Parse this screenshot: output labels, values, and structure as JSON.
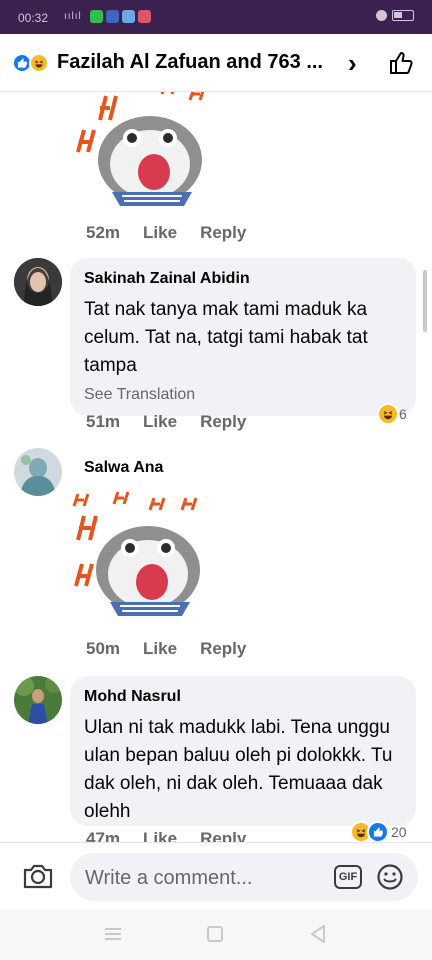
{
  "status_bar": {
    "time": "00:32",
    "signal": "ıılıl"
  },
  "header": {
    "title": "Fazilah Al Zafuan and 763 ...",
    "chevron": "›"
  },
  "sticker": {
    "text_lines": [
      "HA",
      "HA",
      "HA",
      "HA",
      "HA",
      "HA",
      "HA"
    ]
  },
  "comments": [
    {
      "time": "52m",
      "like": "Like",
      "reply": "Reply"
    },
    {
      "author": "Sakinah Zainal Abidin",
      "text": "Tat nak tanya mak tami maduk ka celum. Tat na, tatgi tami habak tat tampa",
      "see_translation": "See Translation",
      "time": "51m",
      "like": "Like",
      "reply": "Reply",
      "reaction_count": "6"
    },
    {
      "author": "Salwa Ana",
      "time": "50m",
      "like": "Like",
      "reply": "Reply"
    },
    {
      "author": "Mohd Nasrul",
      "text": "Ulan ni tak madukk labi. Tena unggu ulan bepan baluu oleh pi dolokkk. Tu dak oleh, ni dak oleh. Temuaaa dak olehh",
      "time": "47m",
      "like": "Like",
      "reply": "Reply",
      "reaction_count": "20"
    }
  ],
  "composer": {
    "placeholder": "Write a comment...",
    "gif_label": "GIF"
  },
  "colors": {
    "status_bar": "#3b2150",
    "facebook_blue": "#1877f2",
    "haha_yellow": "#f7b928",
    "bubble_gray": "#f0f2f5",
    "meta_gray": "#65676b"
  }
}
